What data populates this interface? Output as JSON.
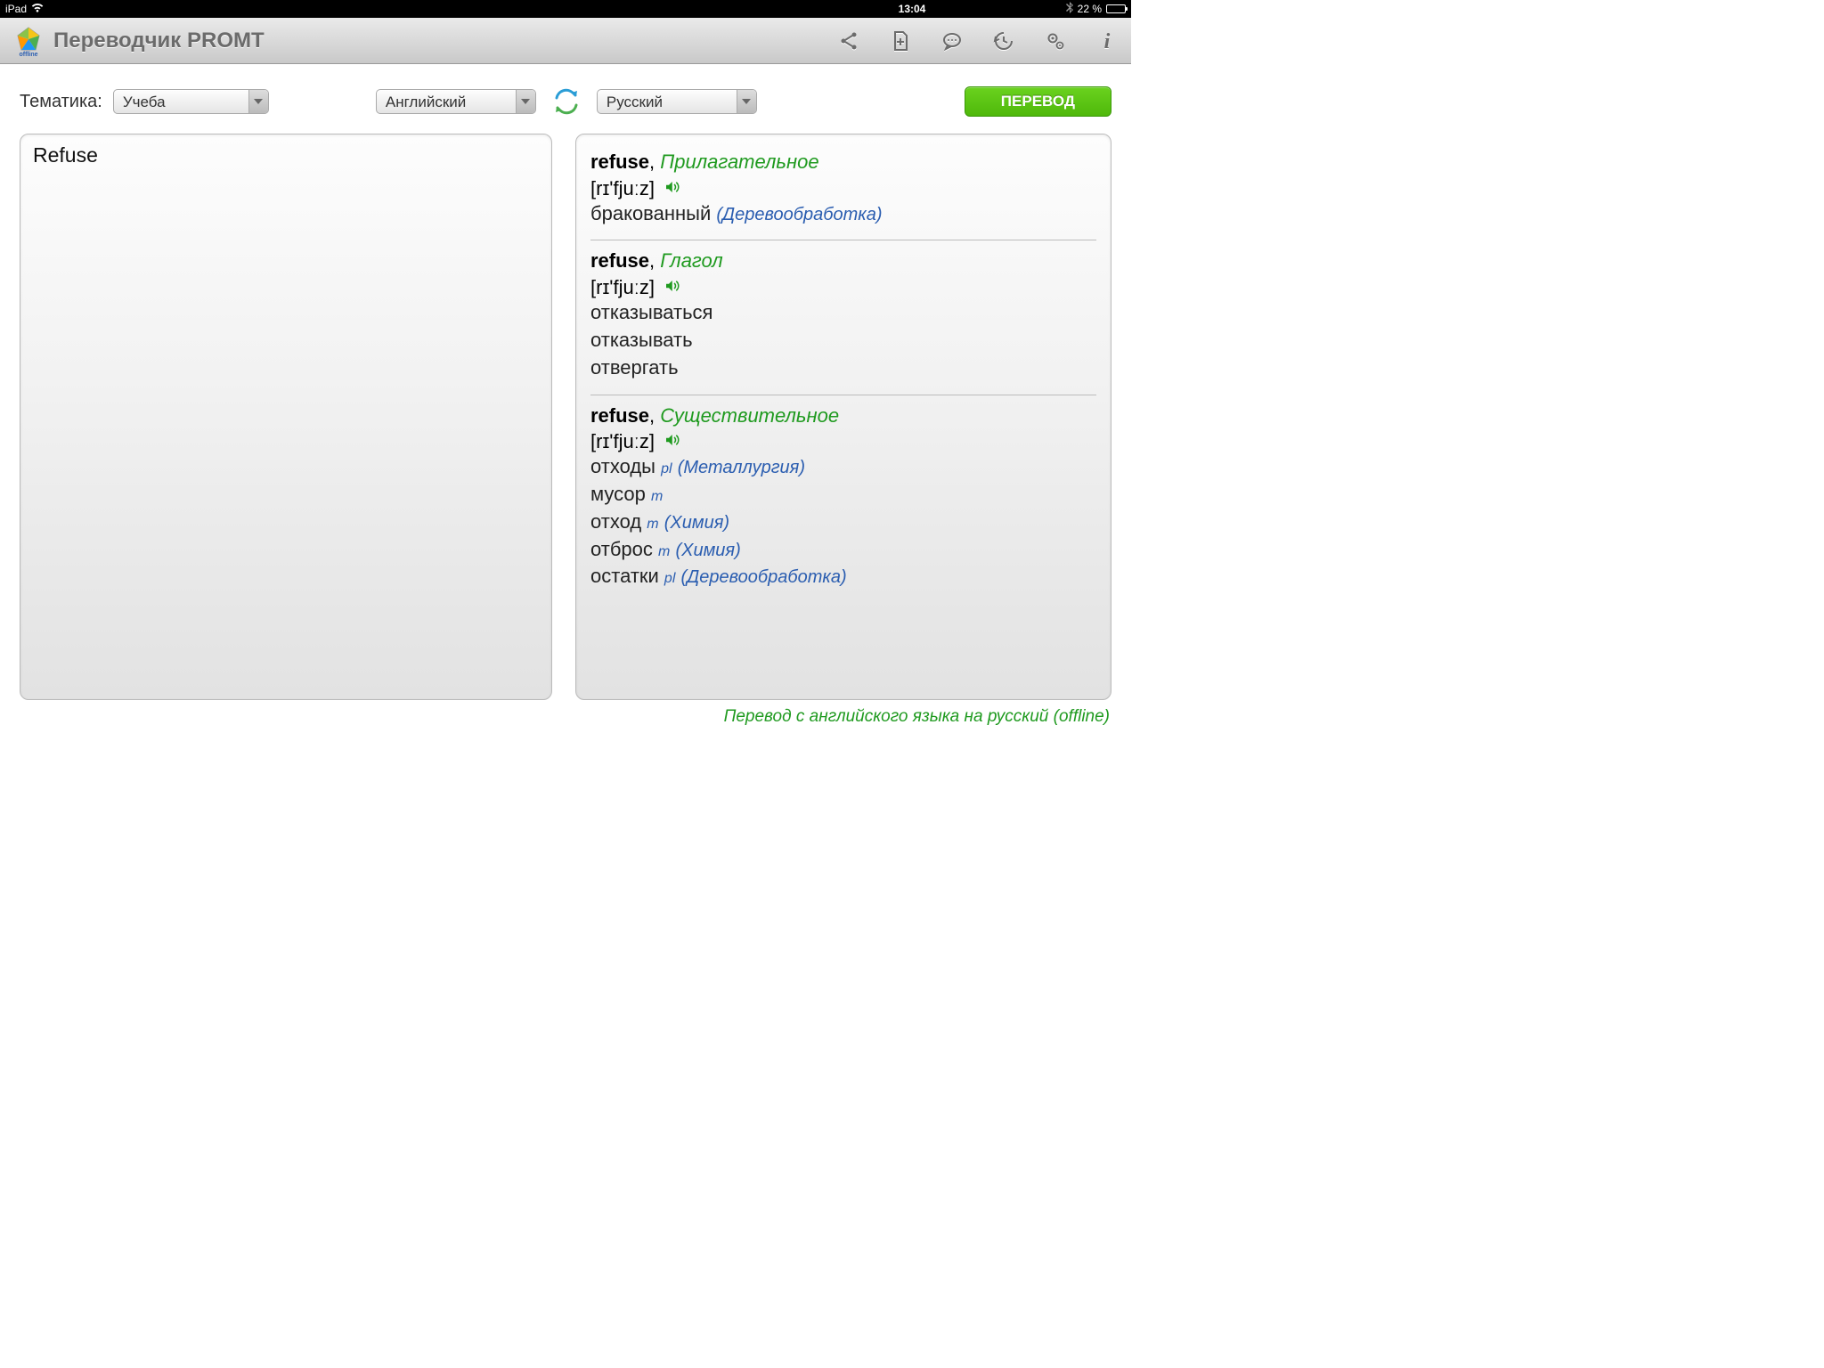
{
  "status": {
    "device": "iPad",
    "time": "13:04",
    "battery": "22 %"
  },
  "header": {
    "title": "Переводчик PROMT",
    "logo_sub": "offline"
  },
  "controls": {
    "topic_label": "Тематика:",
    "topic_value": "Учеба",
    "source_lang": "Английский",
    "target_lang": "Русский",
    "translate_btn": "ПЕРЕВОД"
  },
  "input_text": "Refuse",
  "entries": [
    {
      "word": "refuse",
      "pos": "Прилагательное",
      "phon": "[rɪ'fjuːz]",
      "translations": [
        {
          "word": "бракованный",
          "domain": "(Деревообработка)"
        }
      ]
    },
    {
      "word": "refuse",
      "pos": "Глагол",
      "phon": "[rɪ'fjuːz]",
      "translations": [
        {
          "word": "отказываться"
        },
        {
          "word": "отказывать"
        },
        {
          "word": "отвергать"
        }
      ]
    },
    {
      "word": "refuse",
      "pos": "Существительное",
      "phon": "[rɪ'fjuːz]",
      "translations": [
        {
          "word": "отходы",
          "gram": "pl",
          "domain": "(Металлургия)"
        },
        {
          "word": "мусор",
          "gram": "m"
        },
        {
          "word": "отход",
          "gram": "m",
          "domain": "(Химия)"
        },
        {
          "word": "отброс",
          "gram": "m",
          "domain": "(Химия)"
        },
        {
          "word": "остатки",
          "gram": "pl",
          "domain": "(Деревообработка)"
        }
      ]
    }
  ],
  "footer": "Перевод с английского языка на русский (offline)"
}
